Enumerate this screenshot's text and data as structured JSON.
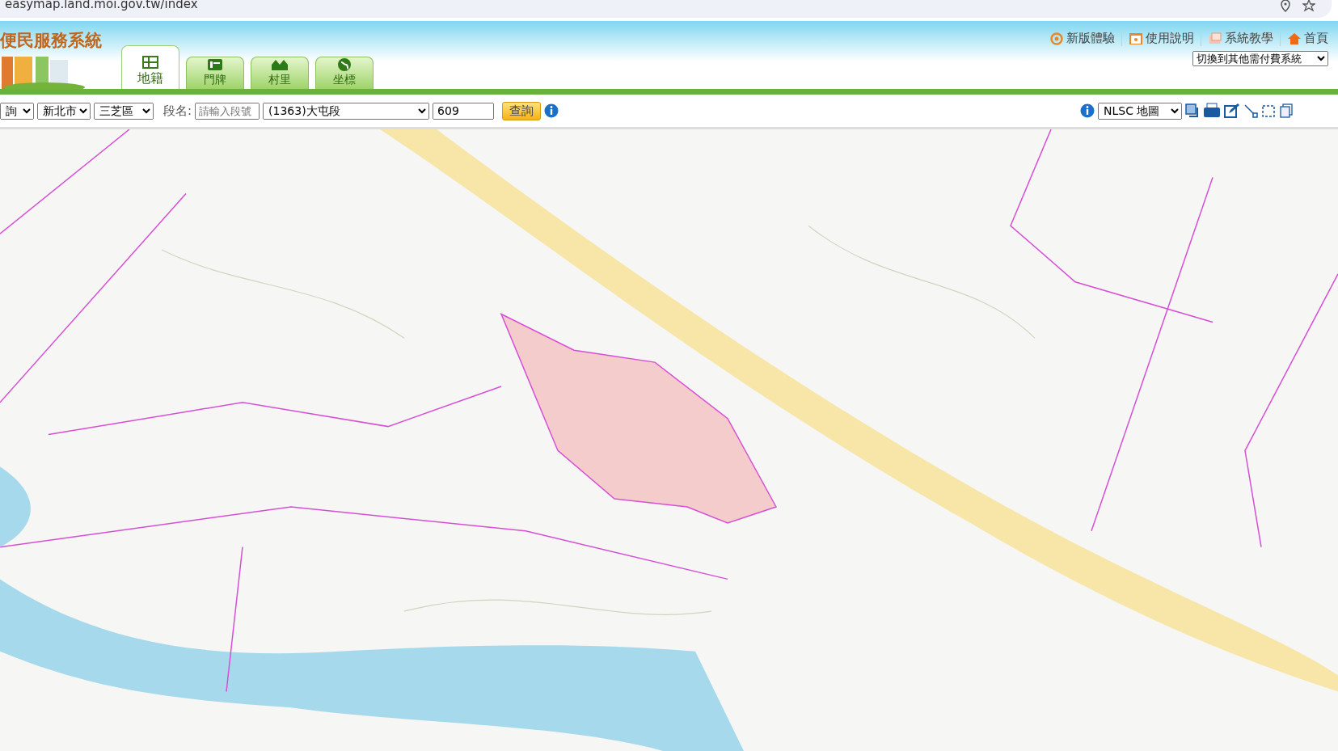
{
  "address_bar": {
    "url": "easymap.land.moi.gov.tw/index"
  },
  "header": {
    "title": "便民服務系統",
    "tabs": [
      {
        "label": "地籍",
        "selected": true
      },
      {
        "label": "門牌",
        "selected": false
      },
      {
        "label": "村里",
        "selected": false
      },
      {
        "label": "坐標",
        "selected": false
      }
    ],
    "links": [
      {
        "label": "新版體驗"
      },
      {
        "label": "使用說明"
      },
      {
        "label": "系統教學"
      },
      {
        "label": "首頁"
      }
    ],
    "system_select": "切換到其他需付費系統"
  },
  "toolbar": {
    "query_type": "詢",
    "city": "新北市",
    "district": "三芝區",
    "section_label": "段名:",
    "section_code": {
      "placeholder": "請輸入段號"
    },
    "section": "(1363)大屯段",
    "parcel": "609",
    "search_button": "查詢",
    "basemap": "NLSC 地圖"
  }
}
